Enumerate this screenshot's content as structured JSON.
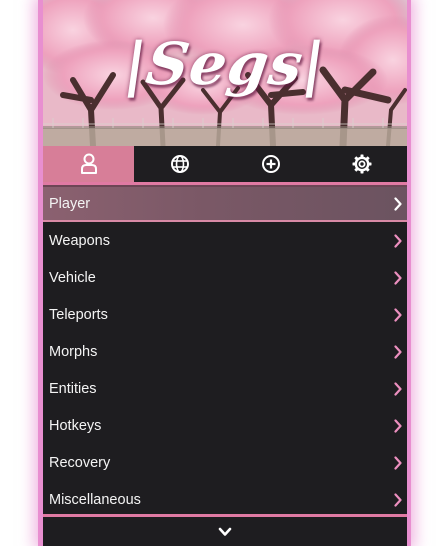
{
  "banner": {
    "title": "|Segs|"
  },
  "tabs": [
    {
      "icon": "user-icon",
      "active": true
    },
    {
      "icon": "globe-icon",
      "active": false
    },
    {
      "icon": "plus-circle-icon",
      "active": false
    },
    {
      "icon": "gear-icon",
      "active": false
    }
  ],
  "menu": {
    "items": [
      {
        "label": "Player",
        "selected": true
      },
      {
        "label": "Weapons"
      },
      {
        "label": "Vehicle"
      },
      {
        "label": "Teleports"
      },
      {
        "label": "Morphs"
      },
      {
        "label": "Entities"
      },
      {
        "label": "Hotkeys"
      },
      {
        "label": "Recovery"
      },
      {
        "label": "Miscellaneous"
      }
    ]
  },
  "footer": {
    "icon": "chevron-down-icon"
  },
  "colors": {
    "accent": "#e07aa3",
    "active_tab": "#d77e98",
    "background": "#1e1d20",
    "selected_row": "#7a5866",
    "chevron": "#ec8fbf"
  }
}
